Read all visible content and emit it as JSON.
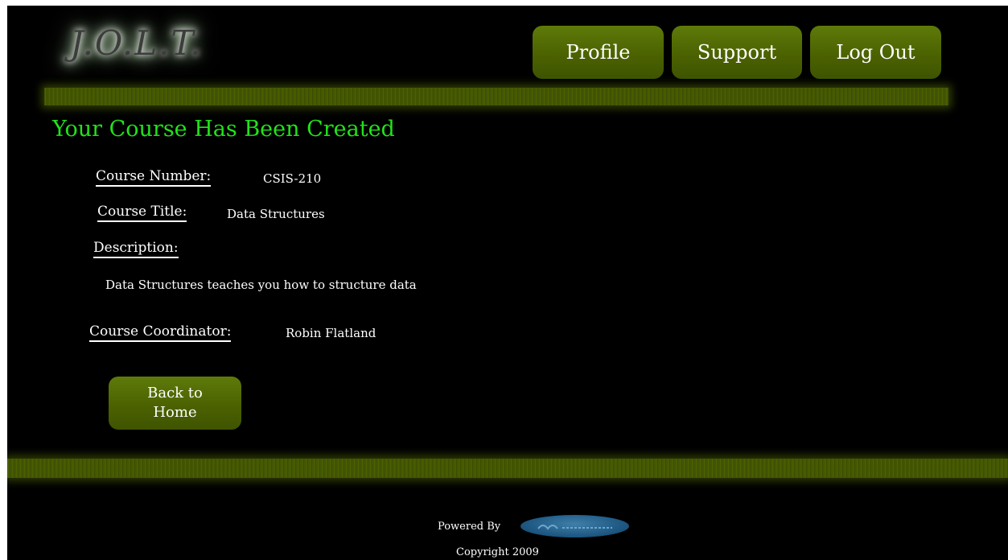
{
  "header": {
    "logo_text": "J.O.L.T.",
    "nav": {
      "profile": "Profile",
      "support": "Support",
      "logout": "Log Out"
    }
  },
  "main": {
    "title": "Your Course Has Been Created",
    "course_number_label": "Course Number:",
    "course_number": "CSIS-210",
    "course_title_label": "Course Title:",
    "course_title": "Data Structures",
    "description_label": "Description:",
    "description": "Data Structures teaches you how to structure data",
    "coordinator_label": "Course Coordinator:",
    "coordinator": "Robin Flatland",
    "back_button": "Back to Home"
  },
  "footer": {
    "powered_by": "Powered By",
    "copyright": "Copyright 2009"
  },
  "colors": {
    "background": "#000000",
    "accent_green": "#22e21a",
    "button_olive": "#4a6000"
  },
  "icons": {
    "sponsor_logo": "sponsor-logo-oval"
  }
}
